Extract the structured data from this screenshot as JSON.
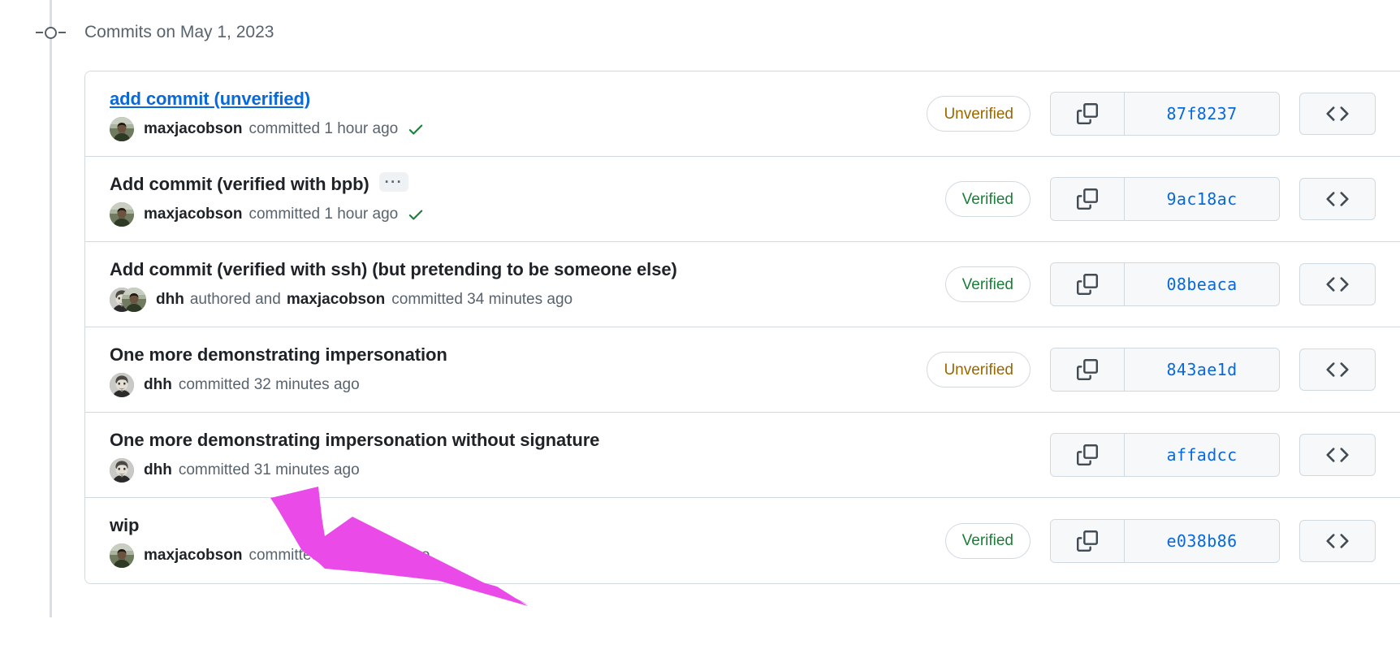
{
  "timeline": {
    "node_icon": "commit-node-icon",
    "group_heading": "Commits on May 1, 2023"
  },
  "colors": {
    "link_blue": "#0969da",
    "verified_green": "#1a7f37",
    "unverified_orange": "#9a6700",
    "border_gray": "#d1d9e0",
    "muted_text": "#59636e",
    "annotation_magenta": "#ea4ae8"
  },
  "commits": [
    {
      "title": "add commit (unverified)",
      "title_is_link": true,
      "has_ellipsis": false,
      "avatars": [
        "maxjacobson"
      ],
      "byline": {
        "author": "maxjacobson",
        "prefix": "",
        "second_author": "",
        "meta": "committed 1 hour ago"
      },
      "has_check": true,
      "verification": "Unverified",
      "verification_state": "unverified",
      "sha": "87f8237",
      "copy_icon": "copy-icon",
      "browse_icon": "code-brackets-icon"
    },
    {
      "title": "Add commit (verified with bpb)",
      "title_is_link": false,
      "has_ellipsis": true,
      "ellipsis_label": "···",
      "avatars": [
        "maxjacobson"
      ],
      "byline": {
        "author": "maxjacobson",
        "prefix": "",
        "second_author": "",
        "meta": "committed 1 hour ago"
      },
      "has_check": true,
      "verification": "Verified",
      "verification_state": "verified",
      "sha": "9ac18ac",
      "copy_icon": "copy-icon",
      "browse_icon": "code-brackets-icon"
    },
    {
      "title": "Add commit (verified with ssh) (but pretending to be someone else)",
      "title_is_link": false,
      "has_ellipsis": false,
      "avatars": [
        "dhh",
        "maxjacobson"
      ],
      "byline": {
        "author": "dhh",
        "prefix": "authored and",
        "second_author": "maxjacobson",
        "meta": "committed 34 minutes ago"
      },
      "has_check": false,
      "verification": "Verified",
      "verification_state": "verified",
      "sha": "08beaca",
      "copy_icon": "copy-icon",
      "browse_icon": "code-brackets-icon"
    },
    {
      "title": "One more demonstrating impersonation",
      "title_is_link": false,
      "has_ellipsis": false,
      "avatars": [
        "dhh"
      ],
      "byline": {
        "author": "dhh",
        "prefix": "",
        "second_author": "",
        "meta": "committed 32 minutes ago"
      },
      "has_check": false,
      "verification": "Unverified",
      "verification_state": "unverified",
      "sha": "843ae1d",
      "copy_icon": "copy-icon",
      "browse_icon": "code-brackets-icon"
    },
    {
      "title": "One more demonstrating impersonation without signature",
      "title_is_link": false,
      "has_ellipsis": false,
      "avatars": [
        "dhh"
      ],
      "byline": {
        "author": "dhh",
        "prefix": "",
        "second_author": "",
        "meta": "committed 31 minutes ago"
      },
      "has_check": false,
      "verification": "",
      "verification_state": "none",
      "sha": "affadcc",
      "copy_icon": "copy-icon",
      "browse_icon": "code-brackets-icon"
    },
    {
      "title": "wip",
      "title_is_link": false,
      "has_ellipsis": false,
      "avatars": [
        "maxjacobson"
      ],
      "byline": {
        "author": "maxjacobson",
        "prefix": "",
        "second_author": "",
        "meta": "committed 15 minutes ago"
      },
      "has_check": false,
      "verification": "Verified",
      "verification_state": "verified",
      "sha": "e038b86",
      "copy_icon": "copy-icon",
      "browse_icon": "code-brackets-icon"
    }
  ],
  "annotation": {
    "type": "arrow",
    "points_to": "dhh-byline-row-5",
    "color": "#ea4ae8"
  }
}
